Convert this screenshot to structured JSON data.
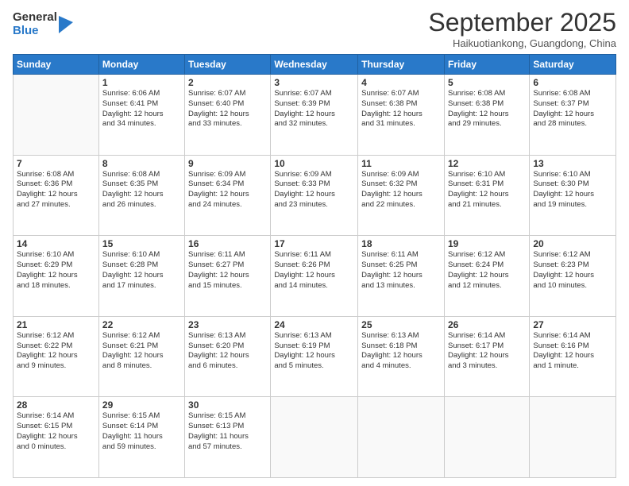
{
  "logo": {
    "general": "General",
    "blue": "Blue"
  },
  "header": {
    "title": "September 2025",
    "subtitle": "Haikuotiankong, Guangdong, China"
  },
  "days_of_week": [
    "Sunday",
    "Monday",
    "Tuesday",
    "Wednesday",
    "Thursday",
    "Friday",
    "Saturday"
  ],
  "weeks": [
    [
      {
        "day": "",
        "info": ""
      },
      {
        "day": "1",
        "info": "Sunrise: 6:06 AM\nSunset: 6:41 PM\nDaylight: 12 hours\nand 34 minutes."
      },
      {
        "day": "2",
        "info": "Sunrise: 6:07 AM\nSunset: 6:40 PM\nDaylight: 12 hours\nand 33 minutes."
      },
      {
        "day": "3",
        "info": "Sunrise: 6:07 AM\nSunset: 6:39 PM\nDaylight: 12 hours\nand 32 minutes."
      },
      {
        "day": "4",
        "info": "Sunrise: 6:07 AM\nSunset: 6:38 PM\nDaylight: 12 hours\nand 31 minutes."
      },
      {
        "day": "5",
        "info": "Sunrise: 6:08 AM\nSunset: 6:38 PM\nDaylight: 12 hours\nand 29 minutes."
      },
      {
        "day": "6",
        "info": "Sunrise: 6:08 AM\nSunset: 6:37 PM\nDaylight: 12 hours\nand 28 minutes."
      }
    ],
    [
      {
        "day": "7",
        "info": "Sunrise: 6:08 AM\nSunset: 6:36 PM\nDaylight: 12 hours\nand 27 minutes."
      },
      {
        "day": "8",
        "info": "Sunrise: 6:08 AM\nSunset: 6:35 PM\nDaylight: 12 hours\nand 26 minutes."
      },
      {
        "day": "9",
        "info": "Sunrise: 6:09 AM\nSunset: 6:34 PM\nDaylight: 12 hours\nand 24 minutes."
      },
      {
        "day": "10",
        "info": "Sunrise: 6:09 AM\nSunset: 6:33 PM\nDaylight: 12 hours\nand 23 minutes."
      },
      {
        "day": "11",
        "info": "Sunrise: 6:09 AM\nSunset: 6:32 PM\nDaylight: 12 hours\nand 22 minutes."
      },
      {
        "day": "12",
        "info": "Sunrise: 6:10 AM\nSunset: 6:31 PM\nDaylight: 12 hours\nand 21 minutes."
      },
      {
        "day": "13",
        "info": "Sunrise: 6:10 AM\nSunset: 6:30 PM\nDaylight: 12 hours\nand 19 minutes."
      }
    ],
    [
      {
        "day": "14",
        "info": "Sunrise: 6:10 AM\nSunset: 6:29 PM\nDaylight: 12 hours\nand 18 minutes."
      },
      {
        "day": "15",
        "info": "Sunrise: 6:10 AM\nSunset: 6:28 PM\nDaylight: 12 hours\nand 17 minutes."
      },
      {
        "day": "16",
        "info": "Sunrise: 6:11 AM\nSunset: 6:27 PM\nDaylight: 12 hours\nand 15 minutes."
      },
      {
        "day": "17",
        "info": "Sunrise: 6:11 AM\nSunset: 6:26 PM\nDaylight: 12 hours\nand 14 minutes."
      },
      {
        "day": "18",
        "info": "Sunrise: 6:11 AM\nSunset: 6:25 PM\nDaylight: 12 hours\nand 13 minutes."
      },
      {
        "day": "19",
        "info": "Sunrise: 6:12 AM\nSunset: 6:24 PM\nDaylight: 12 hours\nand 12 minutes."
      },
      {
        "day": "20",
        "info": "Sunrise: 6:12 AM\nSunset: 6:23 PM\nDaylight: 12 hours\nand 10 minutes."
      }
    ],
    [
      {
        "day": "21",
        "info": "Sunrise: 6:12 AM\nSunset: 6:22 PM\nDaylight: 12 hours\nand 9 minutes."
      },
      {
        "day": "22",
        "info": "Sunrise: 6:12 AM\nSunset: 6:21 PM\nDaylight: 12 hours\nand 8 minutes."
      },
      {
        "day": "23",
        "info": "Sunrise: 6:13 AM\nSunset: 6:20 PM\nDaylight: 12 hours\nand 6 minutes."
      },
      {
        "day": "24",
        "info": "Sunrise: 6:13 AM\nSunset: 6:19 PM\nDaylight: 12 hours\nand 5 minutes."
      },
      {
        "day": "25",
        "info": "Sunrise: 6:13 AM\nSunset: 6:18 PM\nDaylight: 12 hours\nand 4 minutes."
      },
      {
        "day": "26",
        "info": "Sunrise: 6:14 AM\nSunset: 6:17 PM\nDaylight: 12 hours\nand 3 minutes."
      },
      {
        "day": "27",
        "info": "Sunrise: 6:14 AM\nSunset: 6:16 PM\nDaylight: 12 hours\nand 1 minute."
      }
    ],
    [
      {
        "day": "28",
        "info": "Sunrise: 6:14 AM\nSunset: 6:15 PM\nDaylight: 12 hours\nand 0 minutes."
      },
      {
        "day": "29",
        "info": "Sunrise: 6:15 AM\nSunset: 6:14 PM\nDaylight: 11 hours\nand 59 minutes."
      },
      {
        "day": "30",
        "info": "Sunrise: 6:15 AM\nSunset: 6:13 PM\nDaylight: 11 hours\nand 57 minutes."
      },
      {
        "day": "",
        "info": ""
      },
      {
        "day": "",
        "info": ""
      },
      {
        "day": "",
        "info": ""
      },
      {
        "day": "",
        "info": ""
      }
    ]
  ]
}
